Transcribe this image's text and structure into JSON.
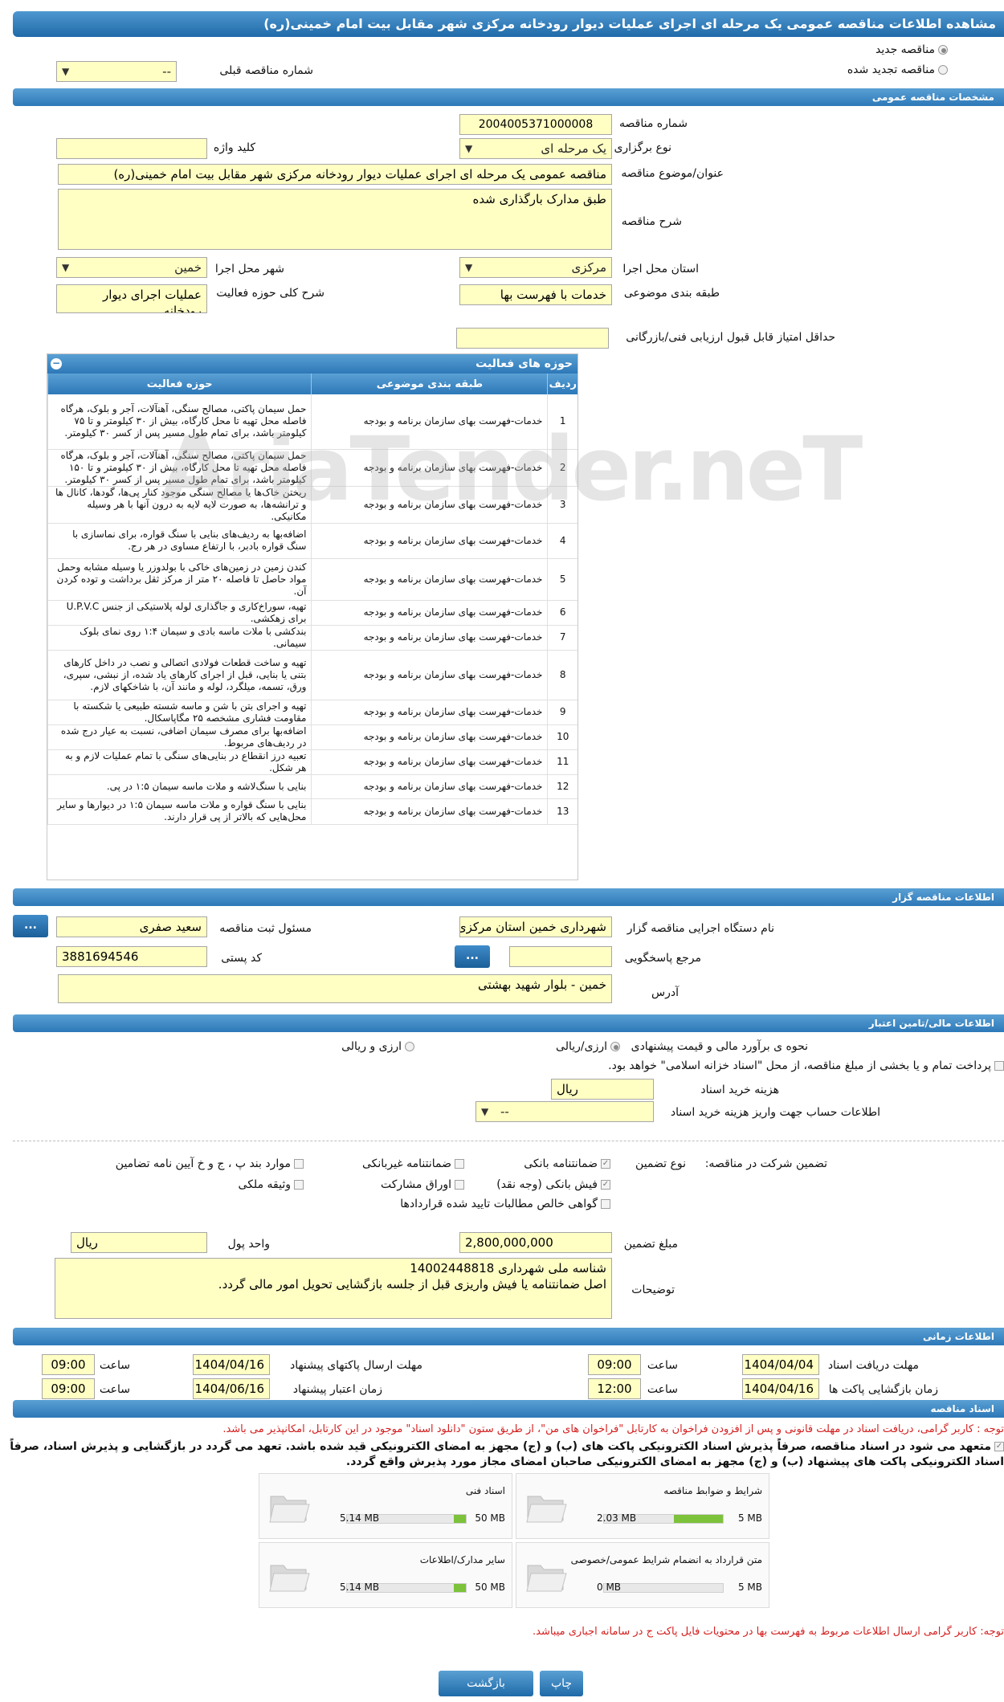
{
  "page_title": "مشاهده اطلاعات مناقصه عمومی یک مرحله ای اجرای عملیات دیوار رودخانه مرکزی شهر مقابل بیت امام خمینی(ره)",
  "header": {
    "new_tender": "مناقصه جدید",
    "renewed_tender": "مناقصه تجدید شده",
    "prev_tender_number_label": "شماره مناقصه قبلی",
    "prev_tender_number_value": "--"
  },
  "general": {
    "section_title": "مشخصات مناقصه عمومی",
    "tender_number_label": "شماره مناقصه",
    "tender_number": "2004005371000008",
    "holding_type_label": "نوع برگزاری",
    "holding_type": "یک مرحله ای",
    "keyword_label": "کلید واژه",
    "keyword": "",
    "subject_label": "عنوان/موضوع مناقصه",
    "subject": "مناقصه عمومی یک مرحله ای اجرای عملیات دیوار رودخانه مرکزی شهر مقابل بیت امام خمینی(ره)",
    "description_label": "شرح مناقصه",
    "description": "طبق مدارک بارگذاری شده",
    "province_label": "استان محل اجرا",
    "province": "مرکزی",
    "city_label": "شهر محل اجرا",
    "city": "خمین",
    "category_label": "طبقه بندی موضوعی",
    "category": "خدمات با فهرست بها",
    "activity_desc_label": "شرح کلی حوزه فعالیت",
    "activity_desc": "عملیات اجرای دیوار رودخانه",
    "min_score_label": "حداقل امتیاز قابل قبول ارزیابی فنی/بازرگانی",
    "min_score": ""
  },
  "activities": {
    "title": "حوزه های فعالیت",
    "col_row": "ردیف",
    "col_category": "طبقه بندی موضوعی",
    "col_activity": "حوزه فعالیت",
    "rows": [
      {
        "n": "1",
        "cat": "خدمات-فهرست بهای سازمان برنامه و بودجه",
        "desc": "حمل سیمان پاکتی، مصالح سنگی، آهنآلات، آجر و بلوک، هرگاه فاصله محل تهیه تا محل کارگاه، بیش از ۳۰ کیلومتر و تا ۷۵ کیلومتر باشد، برای تمام طول مسیر پس از کسر ۳۰ کیلومتر."
      },
      {
        "n": "2",
        "cat": "خدمات-فهرست بهای سازمان برنامه و بودجه",
        "desc": "حمل سیمان پاکتی، مصالح سنگی، آهنآلات، آجر و بلوک، هرگاه فاصله محل تهیه تا محل کارگاه، بیش از ۳۰ کیلومتر و تا ۱۵۰ کیلومتر باشد، برای تمام طول مسیر پس از کسر ۳۰ کیلومتر."
      },
      {
        "n": "3",
        "cat": "خدمات-فهرست بهای سازمان برنامه و بودجه",
        "desc": "ریختن خاک‌ها یا مصالح سنگی موجود کنار پی‌ها، گودها، کانال ها و ترانشه‌ها، به صورت لایه لایه به درون آنها با هر وسیله مکانیکی."
      },
      {
        "n": "4",
        "cat": "خدمات-فهرست بهای سازمان برنامه و بودجه",
        "desc": "اضافه‌بها به ردیف‌های بنایی با سنگ قواره، برای نماسازی با سنگ قواره بادبر، با ارتفاع مساوی در هر رج."
      },
      {
        "n": "5",
        "cat": "خدمات-فهرست بهای سازمان برنامه و بودجه",
        "desc": "کندن زمین در زمین‌های خاکی با بولدوزر یا وسیله مشابه وحمل مواد حاصل تا فاصله ۲۰ متر از مرکز ثقل برداشت و توده کردن آن."
      },
      {
        "n": "6",
        "cat": "خدمات-فهرست بهای سازمان برنامه و بودجه",
        "desc": "تهیه، سوراخ‌کاری و جاگذاری لوله پلاستیکی از جنس U.P.V.C برای زهکشی."
      },
      {
        "n": "7",
        "cat": "خدمات-فهرست بهای سازمان برنامه و بودجه",
        "desc": "بندکشی با ملات ماسه بادی و سیمان ۱:۴ روی نمای بلوک سیمانی."
      },
      {
        "n": "8",
        "cat": "خدمات-فهرست بهای سازمان برنامه و بودجه",
        "desc": "تهیه و ساخت قطعات فولادی اتصالی و نصب در داخل کارهای بتنی یا بنایی، قبل از اجرای کارهای یاد شده، از نبشی، سپری، ورق، تسمه، میلگرد، لوله و مانند آن، با شاخکهای لازم."
      },
      {
        "n": "9",
        "cat": "خدمات-فهرست بهای سازمان برنامه و بودجه",
        "desc": "تهیه و اجرای بتن با شن و ماسه شسته طبیعی یا شکسته با مقاومت فشاری مشخصه ۲۵ مگاپاسکال."
      },
      {
        "n": "10",
        "cat": "خدمات-فهرست بهای سازمان برنامه و بودجه",
        "desc": "اضافه‌بها برای مصرف سیمان اضافی، نسبت به عیار درج شده در ردیف‌های مربوط."
      },
      {
        "n": "11",
        "cat": "خدمات-فهرست بهای سازمان برنامه و بودجه",
        "desc": "تعبیه درز انقطاع در بنایی‌های سنگی با تمام عملیات لازم و به هر شکل."
      },
      {
        "n": "12",
        "cat": "خدمات-فهرست بهای سازمان برنامه و بودجه",
        "desc": "بنایی با سنگ‌لاشه و ملات ماسه سیمان ۱:۵ در پی."
      },
      {
        "n": "13",
        "cat": "خدمات-فهرست بهای سازمان برنامه و بودجه",
        "desc": "بنایی با سنگ قواره و ملات ماسه سیمان ۱:۵ در دیوارها و سایر محل‌هایی که بالاتر از پی قرار دارند."
      }
    ]
  },
  "organizer": {
    "section_title": "اطلاعات مناقصه گزار",
    "org_name_label": "نام دستگاه اجرایی مناقصه گزار",
    "org_name": "شهرداری خمین استان مرکزی",
    "registrar_label": "مسئول ثبت مناقصه",
    "registrar": "سعید صفری",
    "response_ref_label": "مرجع پاسخگویی",
    "response_ref": "",
    "postal_code_label": "کد پستی",
    "postal_code": "3881694546",
    "address_label": "آدرس",
    "address": "خمین - بلوار شهید بهشتی",
    "dots_label": "..."
  },
  "finance": {
    "section_title": "اطلاعات مالی/تامین اعتبار",
    "estimate_label": "نحوه ی برآورد مالی و قیمت پیشنهادی",
    "opt_rial": "ارزی/ریالی",
    "opt_fx": "ارزی و ریالی",
    "treasury_text": "پرداخت تمام و یا بخشی از مبلغ مناقصه، از محل \"اسناد خزانه اسلامی\" خواهد بود.",
    "doc_fee_label": "هزینه خرید اسناد",
    "doc_fee_unit": "ریال",
    "account_label": "اطلاعات حساب جهت واریز هزینه خرید اسناد",
    "account_value": "--"
  },
  "guarantee": {
    "label": "تضمین شرکت در مناقصه:",
    "type_label": "نوع تضمین",
    "opt_bank": "ضمانتنامه بانکی",
    "opt_nonbank": "ضمانتنامه غیربانکی",
    "opt_clauses": "موارد بند پ ، ج و خ آیین نامه تضامین",
    "opt_cheque": "فیش بانکی (وجه نقد)",
    "opt_bonds": "اوراق مشارکت",
    "opt_property": "وثیقه ملکی",
    "opt_claims": "گواهی خالص مطالبات تایید شده قراردادها",
    "amount_label": "مبلغ تضمین",
    "amount": "2,800,000,000",
    "currency_label": "واحد پول",
    "currency": "ریال",
    "notes_label": "توضیحات",
    "notes_line1": "شناسه ملی شهرداری 14002448818",
    "notes_line2": "اصل ضمانتنامه یا فیش واریزی قبل از جلسه بازگشایی تحویل امور مالی گردد."
  },
  "timing": {
    "section_title": "اطلاعات زمانی",
    "doc_receive_label": "مهلت دریافت اسناد",
    "doc_receive_date": "1404/04/04",
    "doc_receive_time": "09:00",
    "submit_deadline_label": "مهلت ارسال پاکتهای پیشنهاد",
    "submit_deadline_date": "1404/04/16",
    "submit_deadline_time": "09:00",
    "opening_label": "زمان بازگشایی پاکت ها",
    "opening_date": "1404/04/16",
    "opening_time": "12:00",
    "validity_label": "زمان اعتبار پیشنهاد",
    "validity_date": "1404/06/16",
    "validity_time": "09:00",
    "time_label": "ساعت"
  },
  "documents": {
    "section_title": "اسناد مناقصه",
    "notice_red": "توجه : کاربر گرامی، دریافت اسناد در مهلت قانونی و پس از افزودن فراخوان به کارتابل \"فراخوان های من\"، از طریق ستون \"دانلود اسناد\" موجود در این کارتابل، امکانپذیر می باشد.",
    "commit_text": "متعهد می شود در اسناد مناقصه، صرفاً پذیرش اسناد الکترونیکی پاکت های (ب) و (ج) مجهز به امضای الکترونیکی قید شده باشد. تعهد می گردد در بازگشایی و پذیرش اسناد، صرفاً اسناد الکترونیکی پاکت های پیشنهاد (ب) و (ج) مجهز به امضای الکترونیکی صاحبان امضای مجاز مورد پذیرش واقع گردد.",
    "files": [
      {
        "name": "شرایط و ضوابط مناقصه",
        "max": "5 MB",
        "current": "2.03 MB",
        "fill": 0.41
      },
      {
        "name": "اسناد فنی",
        "max": "50 MB",
        "current": "5.14 MB",
        "fill": 0.1
      },
      {
        "name": "متن قرارداد به انضمام شرایط عمومی/خصوصی",
        "max": "5 MB",
        "current": "0 MB",
        "fill": 0
      },
      {
        "name": "سایر مدارک/اطلاعات",
        "max": "50 MB",
        "current": "5.14 MB",
        "fill": 0.1
      }
    ],
    "notice_red2": "توجه: کاربر گرامی ارسال اطلاعات مربوط به فهرست بها در محتویات فایل پاکت ج در سامانه اجباری میباشد."
  },
  "actions": {
    "print": "چاپ",
    "back": "بازگشت"
  },
  "watermark": "AriaTender.neT"
}
